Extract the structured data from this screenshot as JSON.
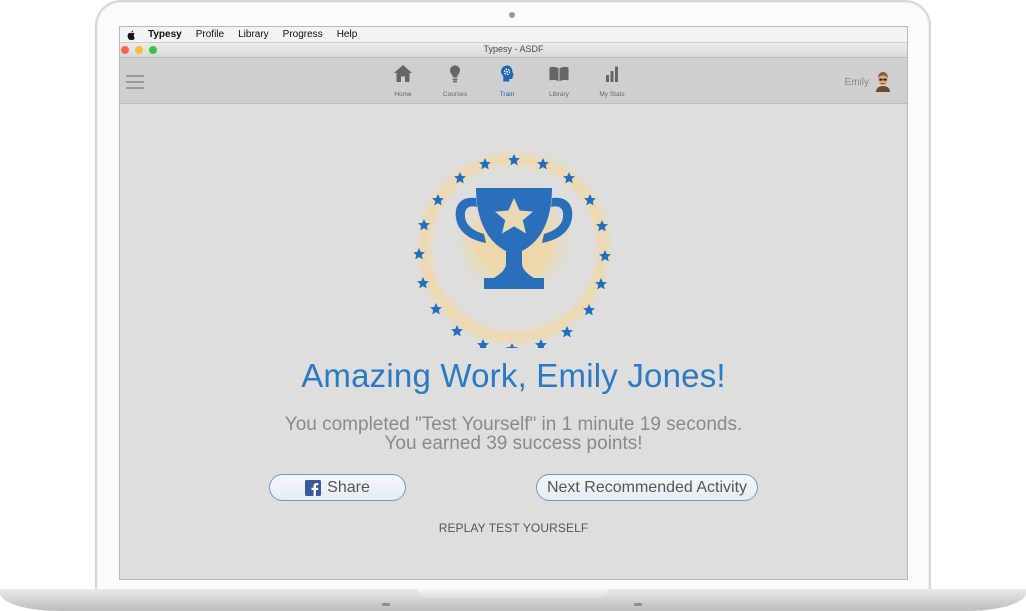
{
  "menubar": {
    "items": [
      "Typesy",
      "Profile",
      "Library",
      "Progress",
      "Help"
    ]
  },
  "window": {
    "title": "Typesy - ASDF"
  },
  "toolbar": {
    "nav": [
      {
        "label": "Home",
        "icon": "home-icon"
      },
      {
        "label": "Courses",
        "icon": "lightbulb-icon"
      },
      {
        "label": "Train",
        "icon": "train-head-icon",
        "active": true
      },
      {
        "label": "Library",
        "icon": "book-icon"
      },
      {
        "label": "My Stats",
        "icon": "bar-chart-icon"
      }
    ],
    "user_name": "Emily"
  },
  "result": {
    "headline": "Amazing Work, Emily Jones!",
    "completed_line": "You completed \"Test Yourself\" in 1 minute 19 seconds.",
    "points_line": "You earned 39 success points!"
  },
  "actions": {
    "share_label": "Share",
    "next_label": "Next Recommended Activity",
    "replay_label": "REPLAY TEST YOURSELF"
  },
  "colors": {
    "accent": "#2a7ac4",
    "trophy": "#2a6fba",
    "glow": "#f3d9a0"
  }
}
